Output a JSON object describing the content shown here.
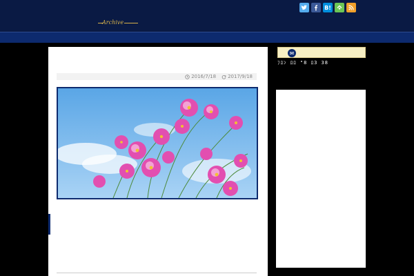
{
  "header": {
    "logo_main": "",
    "logo_sub": "",
    "logo_archive": "Archive"
  },
  "social": [
    {
      "name": "twitter-icon",
      "color": "#55acee"
    },
    {
      "name": "facebook-icon",
      "color": "#3b5998"
    },
    {
      "name": "hatena-bookmark-icon",
      "color": "#008fde",
      "label": "B!"
    },
    {
      "name": "feedly-icon",
      "color": "#6cc655"
    },
    {
      "name": "rss-icon",
      "color": "#f1a02a"
    }
  ],
  "nav": {
    "items": [
      {
        "label": ""
      },
      {
        "label": ""
      },
      {
        "label": ""
      },
      {
        "label": ""
      },
      {
        "label": ""
      },
      {
        "label": ""
      },
      {
        "label": ""
      },
      {
        "label": ""
      },
      {
        "label": ""
      },
      {
        "label": ""
      },
      {
        "label": ""
      }
    ]
  },
  "article": {
    "title": "",
    "published": "2016/7/18",
    "updated": "2017/9/18",
    "quote": "",
    "red_line": "",
    "blue_line": "",
    "sub_heading": ""
  },
  "sidebar": {
    "widget_title": "",
    "clock": "ﾌﾛﾝ ﾛﾛ \"8 ﾛ3 38",
    "ticker": ""
  },
  "colors": {
    "header_bg": "#0a1a44",
    "nav_bg": "#0d2a6e",
    "logo_gold": "#f2c230",
    "red": "#d0021b",
    "blue": "#0b2a8a"
  }
}
